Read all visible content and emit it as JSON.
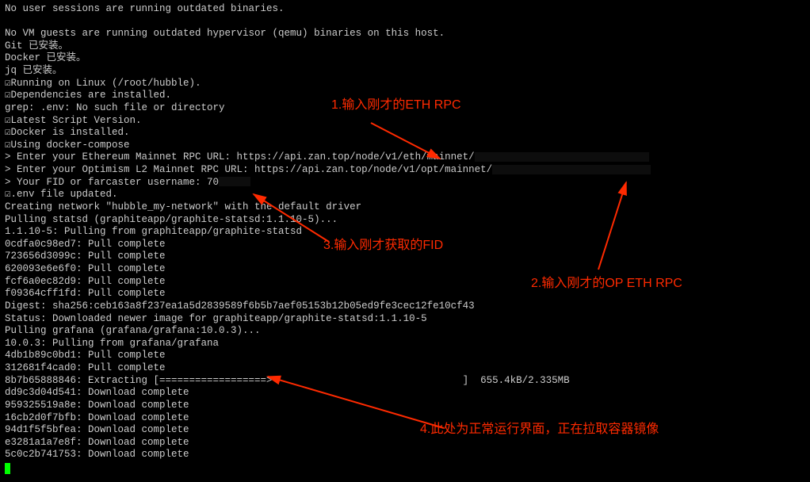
{
  "terminal": {
    "lines": [
      "No user sessions are running outdated binaries.",
      "",
      "No VM guests are running outdated hypervisor (qemu) binaries on this host.",
      "Git 已安装。",
      "Docker 已安装。",
      "jq 已安装。",
      "☑Running on Linux (/root/hubble).",
      "☑Dependencies are installed.",
      "grep: .env: No such file or directory",
      "☑Latest Script Version.",
      "☑Docker is installed.",
      "☑Using docker-compose",
      "> Enter your Ethereum Mainnet RPC URL: https://api.zan.top/node/v1/eth/mainnet/",
      "> Enter your Optimism L2 Mainnet RPC URL: https://api.zan.top/node/v1/opt/mainnet/",
      "> Your FID or farcaster username: 70",
      "☑.env file updated.",
      "Creating network \"hubble_my-network\" with the default driver",
      "Pulling statsd (graphiteapp/graphite-statsd:1.1.10-5)...",
      "1.1.10-5: Pulling from graphiteapp/graphite-statsd",
      "0cdfa0c98ed7: Pull complete",
      "723656d3099c: Pull complete",
      "620093e6e6f0: Pull complete",
      "fcf6a0ec82d9: Pull complete",
      "f09364cff1fd: Pull complete",
      "Digest: sha256:ceb163a8f237ea1a5d2839589f6b5b7aef05153b12b05ed9fe3cec12fe10cf43",
      "Status: Downloaded newer image for graphiteapp/graphite-statsd:1.1.10-5",
      "Pulling grafana (grafana/grafana:10.0.3)...",
      "10.0.3: Pulling from grafana/grafana",
      "4db1b89c0bd1: Pull complete",
      "312681f4cad0: Pull complete",
      "8b7b65888846: Extracting [==================>                                ]  655.4kB/2.335MB",
      "dd9c3d04d541: Download complete",
      "959325519a8e: Download complete",
      "16cb2d0f7bfb: Download complete",
      "94d1f5f5bfea: Download complete",
      "e3281a1a7e8f: Download complete",
      "5c0c2b741753: Download complete"
    ],
    "eth_rpc_value": "https://api.zan.top/node/v1/eth/mainnet/",
    "op_rpc_value": "https://api.zan.top/node/v1/opt/mainnet/",
    "fid_value": "70",
    "extract_progress": "655.4kB/2.335MB"
  },
  "annotations": {
    "a1": "1.输入刚才的ETH RPC",
    "a2": "2.输入刚才的OP ETH RPC",
    "a3": "3.输入刚才获取的FID",
    "a4": "4.此处为正常运行界面，正在拉取容器镜像"
  }
}
